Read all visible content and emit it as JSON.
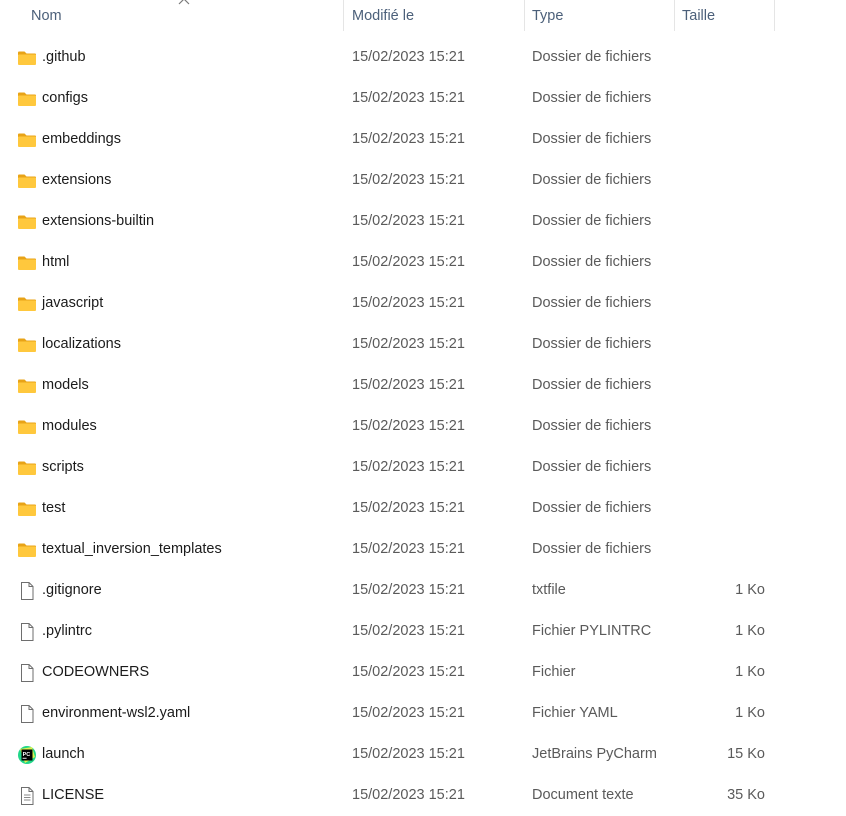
{
  "columns": {
    "name": "Nom",
    "modified": "Modifié le",
    "type": "Type",
    "size": "Taille"
  },
  "sort": {
    "column": "Nom",
    "indicator": "chevron-up-icon"
  },
  "colors": {
    "folder": "#ffc83d",
    "folder_dark": "#e8a317",
    "header_text": "#4c607a",
    "pycharm_green": "#21d789"
  },
  "files": [
    {
      "name": ".github",
      "modified": "15/02/2023 15:21",
      "type": "Dossier de fichiers",
      "size": "",
      "icon": "folder-icon"
    },
    {
      "name": "configs",
      "modified": "15/02/2023 15:21",
      "type": "Dossier de fichiers",
      "size": "",
      "icon": "folder-icon"
    },
    {
      "name": "embeddings",
      "modified": "15/02/2023 15:21",
      "type": "Dossier de fichiers",
      "size": "",
      "icon": "folder-icon"
    },
    {
      "name": "extensions",
      "modified": "15/02/2023 15:21",
      "type": "Dossier de fichiers",
      "size": "",
      "icon": "folder-icon"
    },
    {
      "name": "extensions-builtin",
      "modified": "15/02/2023 15:21",
      "type": "Dossier de fichiers",
      "size": "",
      "icon": "folder-icon"
    },
    {
      "name": "html",
      "modified": "15/02/2023 15:21",
      "type": "Dossier de fichiers",
      "size": "",
      "icon": "folder-icon"
    },
    {
      "name": "javascript",
      "modified": "15/02/2023 15:21",
      "type": "Dossier de fichiers",
      "size": "",
      "icon": "folder-icon"
    },
    {
      "name": "localizations",
      "modified": "15/02/2023 15:21",
      "type": "Dossier de fichiers",
      "size": "",
      "icon": "folder-icon"
    },
    {
      "name": "models",
      "modified": "15/02/2023 15:21",
      "type": "Dossier de fichiers",
      "size": "",
      "icon": "folder-icon"
    },
    {
      "name": "modules",
      "modified": "15/02/2023 15:21",
      "type": "Dossier de fichiers",
      "size": "",
      "icon": "folder-icon"
    },
    {
      "name": "scripts",
      "modified": "15/02/2023 15:21",
      "type": "Dossier de fichiers",
      "size": "",
      "icon": "folder-icon"
    },
    {
      "name": "test",
      "modified": "15/02/2023 15:21",
      "type": "Dossier de fichiers",
      "size": "",
      "icon": "folder-icon"
    },
    {
      "name": "textual_inversion_templates",
      "modified": "15/02/2023 15:21",
      "type": "Dossier de fichiers",
      "size": "",
      "icon": "folder-icon"
    },
    {
      "name": ".gitignore",
      "modified": "15/02/2023 15:21",
      "type": "txtfile",
      "size": "1 Ko",
      "icon": "file-icon"
    },
    {
      "name": ".pylintrc",
      "modified": "15/02/2023 15:21",
      "type": "Fichier PYLINTRC",
      "size": "1 Ko",
      "icon": "file-icon"
    },
    {
      "name": "CODEOWNERS",
      "modified": "15/02/2023 15:21",
      "type": "Fichier",
      "size": "1 Ko",
      "icon": "file-icon"
    },
    {
      "name": "environment-wsl2.yaml",
      "modified": "15/02/2023 15:21",
      "type": "Fichier YAML",
      "size": "1 Ko",
      "icon": "file-icon"
    },
    {
      "name": "launch",
      "modified": "15/02/2023 15:21",
      "type": "JetBrains PyCharm",
      "size": "15 Ko",
      "icon": "pycharm-icon"
    },
    {
      "name": "LICENSE",
      "modified": "15/02/2023 15:21",
      "type": "Document texte",
      "size": "35 Ko",
      "icon": "text-document-icon"
    }
  ]
}
